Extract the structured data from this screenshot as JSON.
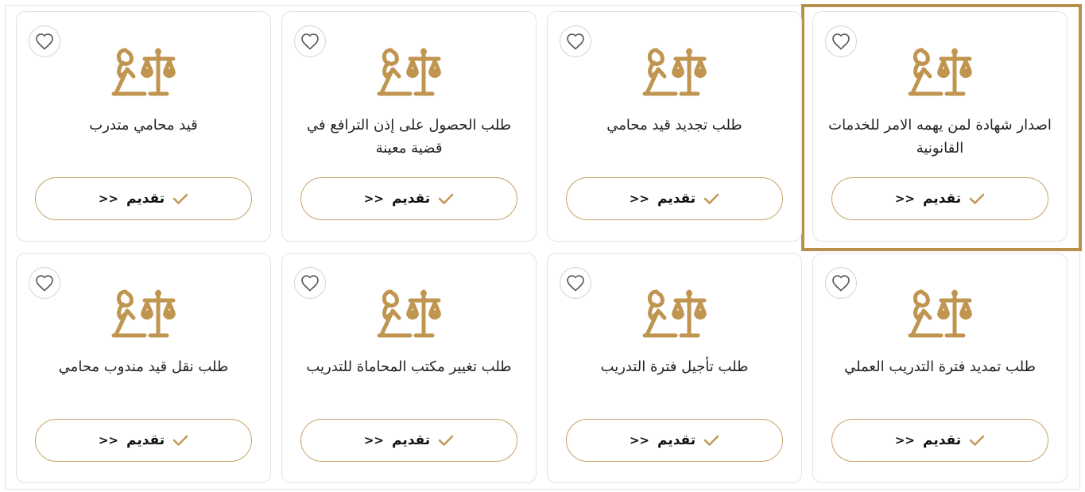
{
  "theme": {
    "accent": "#b88f4b",
    "button_border": "#c6a26a",
    "card_border": "#e3e3e3"
  },
  "services": [
    {
      "title": "اصدار شهادة لمن يهمه الامر للخدمات القانونية",
      "button_label": "تقديم",
      "button_arrows": ">>",
      "selected": true,
      "favorite": false,
      "icon": "lawyer-scales-icon"
    },
    {
      "title": "طلب تجديد قيد محامي",
      "button_label": "تقديم",
      "button_arrows": ">>",
      "selected": false,
      "favorite": false,
      "icon": "lawyer-scales-icon"
    },
    {
      "title": "طلب الحصول على إذن الترافع في قضية معينة",
      "button_label": "تقديم",
      "button_arrows": ">>",
      "selected": false,
      "favorite": false,
      "icon": "lawyer-scales-icon"
    },
    {
      "title": "قيد محامي متدرب",
      "button_label": "تقديم",
      "button_arrows": ">>",
      "selected": false,
      "favorite": false,
      "icon": "lawyer-scales-icon"
    },
    {
      "title": "طلب تمديد فترة التدريب العملي",
      "button_label": "تقديم",
      "button_arrows": ">>",
      "selected": false,
      "favorite": false,
      "icon": "lawyer-scales-icon"
    },
    {
      "title": "طلب تأجيل فترة التدريب",
      "button_label": "تقديم",
      "button_arrows": ">>",
      "selected": false,
      "favorite": false,
      "icon": "lawyer-scales-icon"
    },
    {
      "title": "طلب تغيير مكتب المحاماة للتدريب",
      "button_label": "تقديم",
      "button_arrows": ">>",
      "selected": false,
      "favorite": false,
      "icon": "lawyer-scales-icon"
    },
    {
      "title": "طلب نقل قيد مندوب محامي",
      "button_label": "تقديم",
      "button_arrows": ">>",
      "selected": false,
      "favorite": false,
      "icon": "lawyer-scales-icon"
    }
  ]
}
